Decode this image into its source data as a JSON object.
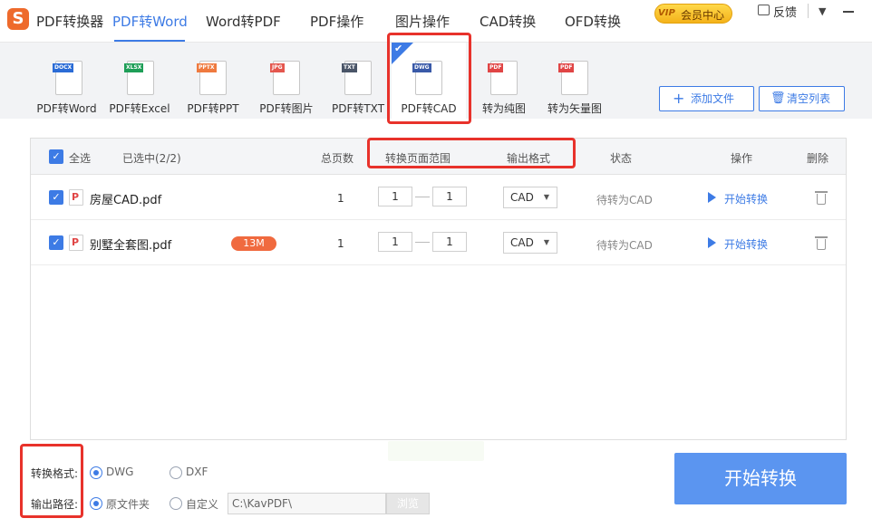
{
  "app": {
    "logo_letter": "S",
    "title": "PDF转换器"
  },
  "nav_tabs": [
    {
      "label": "PDF转Word",
      "active": true
    },
    {
      "label": "Word转PDF",
      "active": false
    },
    {
      "label": "PDF操作",
      "active": false
    },
    {
      "label": "图片操作",
      "active": false
    },
    {
      "label": "CAD转换",
      "active": false
    },
    {
      "label": "OFD转换",
      "active": false
    }
  ],
  "topbar": {
    "vip_mark": "VIP",
    "vip_label": "会员中心",
    "feedback_label": "反馈",
    "menu_icon": "▼"
  },
  "tools": [
    {
      "label": "PDF转Word",
      "tag": "DOCX",
      "tag_color": "#2b6cd6",
      "active": false
    },
    {
      "label": "PDF转Excel",
      "tag": "XLSX",
      "tag_color": "#1e9e57",
      "active": false
    },
    {
      "label": "PDF转PPT",
      "tag": "PPTX",
      "tag_color": "#ef7a3f",
      "active": false
    },
    {
      "label": "PDF转图片",
      "tag": "JPG",
      "tag_color": "#e4574e",
      "active": false
    },
    {
      "label": "PDF转TXT",
      "tag": "TXT",
      "tag_color": "#4a5568",
      "active": false
    },
    {
      "label": "PDF转CAD",
      "tag": "DWG",
      "tag_color": "#3a5aa8",
      "active": true
    },
    {
      "label": "转为纯图",
      "tag": "PDF",
      "tag_color": "#e04545",
      "active": false
    },
    {
      "label": "转为矢量图",
      "tag": "PDF",
      "tag_color": "#e04545",
      "active": false
    }
  ],
  "actions": {
    "add_file": "添加文件",
    "clear_list": "清空列表",
    "add_icon": "+"
  },
  "table": {
    "select_all": "全选",
    "selected_count": "已选中(2/2)",
    "headers": {
      "pages": "总页数",
      "range": "转换页面范围",
      "format": "输出格式",
      "status": "状态",
      "operation": "操作",
      "delete": "删除"
    },
    "rows": [
      {
        "name": "房屋CAD.pdf",
        "size": "",
        "pages": "1",
        "range_from": "1",
        "range_to": "1",
        "format": "CAD",
        "status": "待转为CAD",
        "action": "开始转换"
      },
      {
        "name": "别墅全套图.pdf",
        "size": "13M",
        "pages": "1",
        "range_from": "1",
        "range_to": "1",
        "format": "CAD",
        "status": "待转为CAD",
        "action": "开始转换"
      }
    ]
  },
  "options": {
    "format_label": "转换格式:",
    "format_dwg": "DWG",
    "format_dxf": "DXF",
    "path_label": "输出路径:",
    "path_original": "原文件夹",
    "path_custom": "自定义",
    "path_value": "C:\\KavPDF\\",
    "browse": "浏览"
  },
  "start_button": "开始转换",
  "colors": {
    "accent": "#3d7be5",
    "start_button": "#5b95f0",
    "highlight": "#e8322b",
    "badge": "#f06a3f"
  }
}
